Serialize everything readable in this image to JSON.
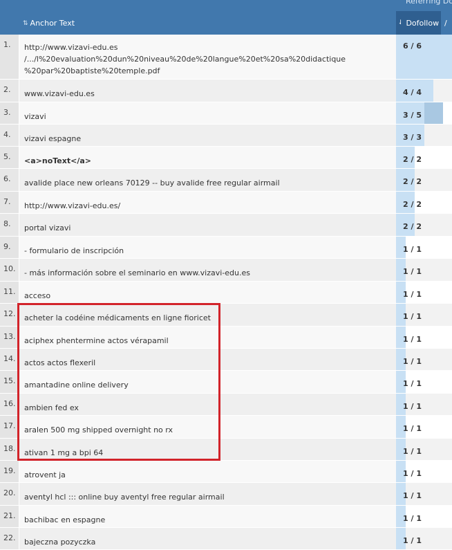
{
  "header": {
    "top_group_label": "Referring Do",
    "anchor_label": "Anchor Text",
    "dofollow_label": "Dofollow",
    "slash_label": "/"
  },
  "rows": [
    {
      "num": "1.",
      "anchor_lines": [
        "http://www.vizavi-edu.es",
        "/.../l%20evaluation%20dun%20niveau%20de%20langue%20et%20sa%20didactique",
        "%20par%20baptiste%20temple.pdf"
      ],
      "df": "6 / 6",
      "share": 1.0,
      "total_share": 1.0
    },
    {
      "num": "2.",
      "anchor_lines": [
        "www.vizavi-edu.es"
      ],
      "df": "4 / 4",
      "share": 0.667,
      "total_share": 0.667
    },
    {
      "num": "3.",
      "anchor_lines": [
        "vizavi"
      ],
      "df": "3 / 5",
      "share": 0.5,
      "total_share": 0.833
    },
    {
      "num": "4.",
      "anchor_lines": [
        "vizavi espagne"
      ],
      "df": "3 / 3",
      "share": 0.5,
      "total_share": 0.5
    },
    {
      "num": "5.",
      "anchor_lines": [
        "<a>noText</a>"
      ],
      "df": "2 / 2",
      "share": 0.333,
      "total_share": 0.333,
      "bold": true
    },
    {
      "num": "6.",
      "anchor_lines": [
        "avalide place new orleans 70129 -- buy avalide free regular airmail"
      ],
      "df": "2 / 2",
      "share": 0.333,
      "total_share": 0.333
    },
    {
      "num": "7.",
      "anchor_lines": [
        "http://www.vizavi-edu.es/"
      ],
      "df": "2 / 2",
      "share": 0.333,
      "total_share": 0.333
    },
    {
      "num": "8.",
      "anchor_lines": [
        "portal vizavi"
      ],
      "df": "2 / 2",
      "share": 0.333,
      "total_share": 0.333
    },
    {
      "num": "9.",
      "anchor_lines": [
        "- formulario de inscripción"
      ],
      "df": "1 / 1",
      "share": 0.167,
      "total_share": 0.167
    },
    {
      "num": "10.",
      "anchor_lines": [
        "- más información sobre el seminario en www.vizavi-edu.es"
      ],
      "df": "1 / 1",
      "share": 0.167,
      "total_share": 0.167
    },
    {
      "num": "11.",
      "anchor_lines": [
        "acceso"
      ],
      "df": "1 / 1",
      "share": 0.167,
      "total_share": 0.167
    },
    {
      "num": "12.",
      "anchor_lines": [
        "acheter la codéine médicaments en ligne fioricet"
      ],
      "df": "1 / 1",
      "share": 0.167,
      "total_share": 0.167
    },
    {
      "num": "13.",
      "anchor_lines": [
        "aciphex phentermine actos vérapamil"
      ],
      "df": "1 / 1",
      "share": 0.167,
      "total_share": 0.167
    },
    {
      "num": "14.",
      "anchor_lines": [
        "actos actos flexeril"
      ],
      "df": "1 / 1",
      "share": 0.167,
      "total_share": 0.167
    },
    {
      "num": "15.",
      "anchor_lines": [
        "amantadine online delivery"
      ],
      "df": "1 / 1",
      "share": 0.167,
      "total_share": 0.167
    },
    {
      "num": "16.",
      "anchor_lines": [
        "ambien fed ex"
      ],
      "df": "1 / 1",
      "share": 0.167,
      "total_share": 0.167
    },
    {
      "num": "17.",
      "anchor_lines": [
        "aralen 500 mg shipped overnight no rx"
      ],
      "df": "1 / 1",
      "share": 0.167,
      "total_share": 0.167
    },
    {
      "num": "18.",
      "anchor_lines": [
        "ativan 1 mg a bpi 64"
      ],
      "df": "1 / 1",
      "share": 0.167,
      "total_share": 0.167
    },
    {
      "num": "19.",
      "anchor_lines": [
        "atrovent ja"
      ],
      "df": "1 / 1",
      "share": 0.167,
      "total_share": 0.167
    },
    {
      "num": "20.",
      "anchor_lines": [
        "aventyl hcl ::: online buy aventyl free regular airmail"
      ],
      "df": "1 / 1",
      "share": 0.167,
      "total_share": 0.167
    },
    {
      "num": "21.",
      "anchor_lines": [
        "bachibac en espagne"
      ],
      "df": "1 / 1",
      "share": 0.167,
      "total_share": 0.167
    },
    {
      "num": "22.",
      "anchor_lines": [
        "bajeczna pozyczka"
      ],
      "df": "1 / 1",
      "share": 0.167,
      "total_share": 0.167
    }
  ],
  "colors": {
    "header": "#4178ad",
    "active_header": "#2f5f90",
    "bar": "#c8e0f4",
    "bar_total": "#a9c8e2",
    "highlight": "#d2232a"
  }
}
